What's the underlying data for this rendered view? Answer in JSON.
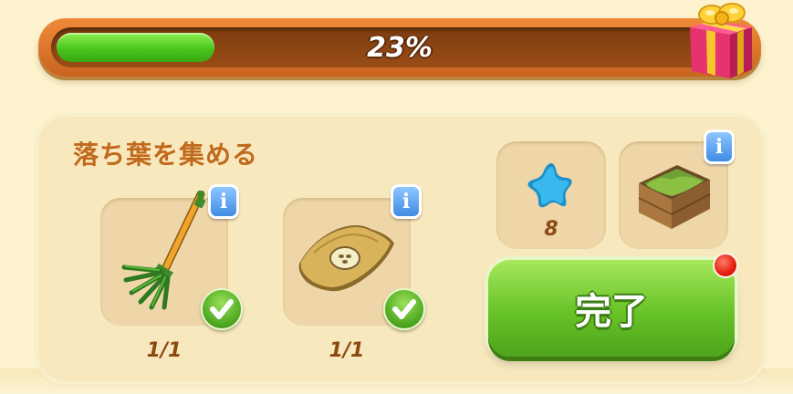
{
  "progress": {
    "percent_label": "23%",
    "fraction": 0.23,
    "fill_color": "#46c21a",
    "reward_icon": "gift-box-icon"
  },
  "task": {
    "title": "落ち葉を集める",
    "requirements": [
      {
        "name": "rake",
        "icon": "rake-icon",
        "count": "1/1",
        "completed": true,
        "info_label": "i"
      },
      {
        "name": "seed-cloth",
        "icon": "seed-cloth-icon",
        "count": "1/1",
        "completed": true,
        "info_label": "i"
      }
    ],
    "rewards": [
      {
        "name": "blue-star-currency",
        "icon": "blue-star-icon",
        "amount": "8"
      },
      {
        "name": "leaf-crate",
        "icon": "leaf-crate-icon",
        "info_label": "i"
      }
    ],
    "complete_button_label": "完了",
    "notification_dot": true
  },
  "colors": {
    "background": "#fdf4cf",
    "title": "#c1691c",
    "count_text": "#8a4a12",
    "button_green": "#67c228",
    "info_blue": "#3f8be3",
    "notification_red": "#e51d0c"
  }
}
